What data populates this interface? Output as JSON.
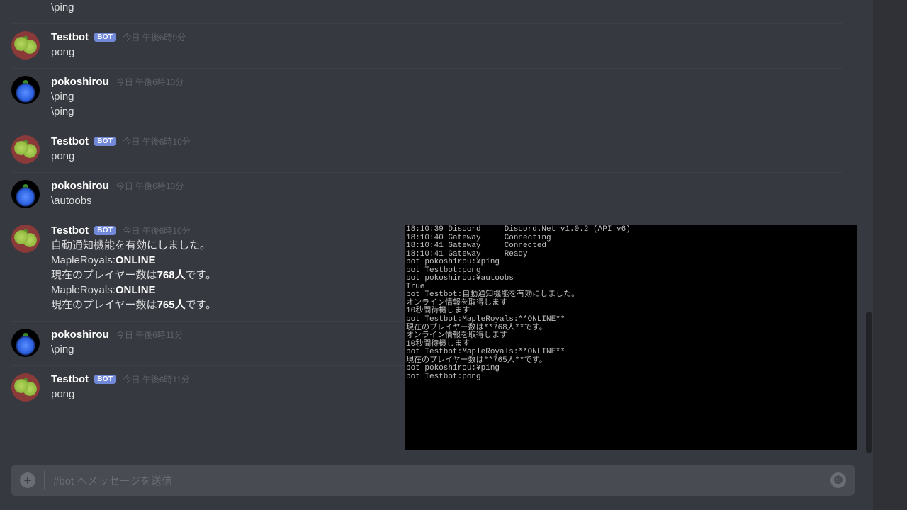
{
  "users": {
    "testbot": "Testbot",
    "pokoshirou": "pokoshirou"
  },
  "bot_badge": "BOT",
  "messages": {
    "m0": {
      "content": [
        "\\ping"
      ]
    },
    "m1": {
      "author": "testbot",
      "ts": "今日 午後6時9分",
      "content": [
        "pong"
      ]
    },
    "m2": {
      "author": "pokoshirou",
      "ts": "今日 午後6時10分",
      "content": [
        "\\ping",
        "\\ping"
      ]
    },
    "m3": {
      "author": "testbot",
      "ts": "今日 午後6時10分",
      "content": [
        "pong"
      ]
    },
    "m4": {
      "author": "pokoshirou",
      "ts": "今日 午後6時10分",
      "content": [
        "\\autoobs"
      ]
    },
    "m5": {
      "author": "testbot",
      "ts": "今日 午後6時10分",
      "lines": {
        "l0": "自動通知機能を有効にしました。",
        "l1a": "MapleRoyals:",
        "l1b": "ONLINE",
        "l2a": "現在のプレイヤー数は",
        "l2b": "768人",
        "l2c": "です。",
        "l3a": "MapleRoyals:",
        "l3b": "ONLINE",
        "l4a": "現在のプレイヤー数は",
        "l4b": "765人",
        "l4c": "です。"
      }
    },
    "m6": {
      "author": "pokoshirou",
      "ts": "今日 午後6時11分",
      "content": [
        "\\ping"
      ]
    },
    "m7": {
      "author": "testbot",
      "ts": "今日 午後6時11分",
      "content": [
        "pong"
      ]
    }
  },
  "input": {
    "placeholder": "#bot へメッセージを送信"
  },
  "console_lines": [
    "18:10:39 Discord     Discord.Net v1.0.2 (API v6)",
    "18:10:40 Gateway     Connecting",
    "18:10:41 Gateway     Connected",
    "18:10:41 Gateway     Ready",
    "bot pokoshirou:¥ping",
    "bot Testbot:pong",
    "bot pokoshirou:¥autoobs",
    "True",
    "bot Testbot:自動通知機能を有効にしました。",
    "オンライン情報を取得します",
    "10秒間待機します",
    "bot Testbot:MapleRoyals:**ONLINE**",
    "現在のプレイヤー数は**768人**です。",
    "オンライン情報を取得します",
    "10秒間待機します",
    "bot Testbot:MapleRoyals:**ONLINE**",
    "現在のプレイヤー数は**765人**です。",
    "bot pokoshirou:¥ping",
    "bot Testbot:pong"
  ]
}
